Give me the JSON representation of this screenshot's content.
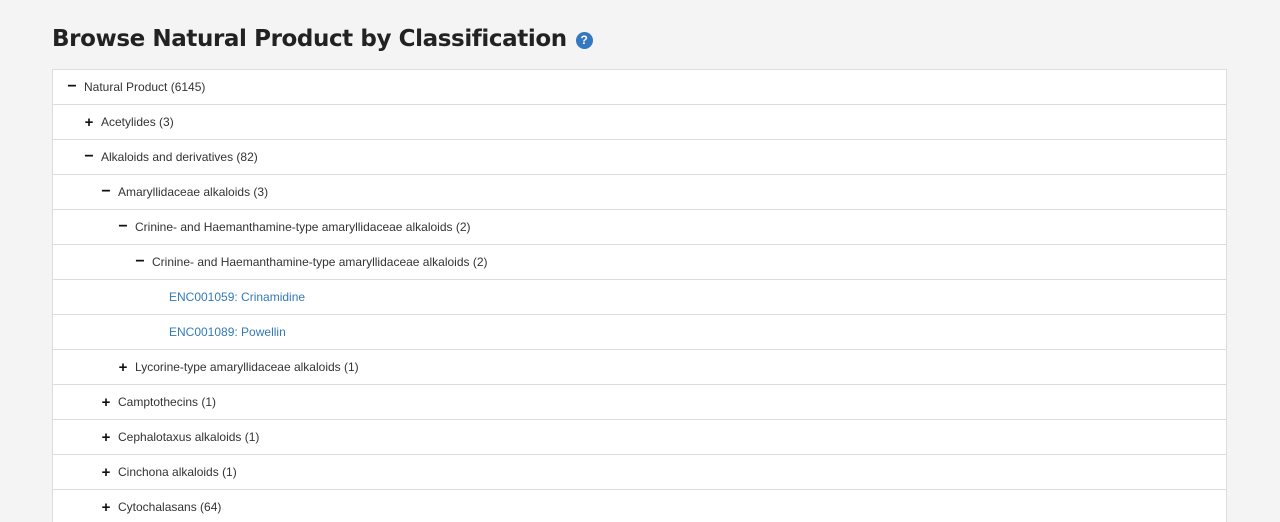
{
  "header": {
    "title": "Browse Natural Product by Classification",
    "help_icon": "question-circle-icon"
  },
  "colors": {
    "link": "#337ab7",
    "help_icon": "#3478c1",
    "border": "#dddddd",
    "page_background": "#f4f4f4"
  },
  "tree": {
    "rows": [
      {
        "id": "natural-product",
        "toggle": "−",
        "toggle_icon": "minus-icon",
        "label": "Natural Product (6145)"
      },
      {
        "id": "acetylides",
        "toggle": "+",
        "toggle_icon": "plus-icon",
        "label": "Acetylides (3)"
      },
      {
        "id": "alkaloids",
        "toggle": "−",
        "toggle_icon": "minus-icon",
        "label": "Alkaloids and derivatives (82)"
      },
      {
        "id": "amaryllidaceae",
        "toggle": "−",
        "toggle_icon": "minus-icon",
        "label": "Amaryllidaceae alkaloids (3)"
      },
      {
        "id": "crinine-1",
        "toggle": "−",
        "toggle_icon": "minus-icon",
        "label": "Crinine- and Haemanthamine-type amaryllidaceae alkaloids (2)"
      },
      {
        "id": "crinine-2",
        "toggle": "−",
        "toggle_icon": "minus-icon",
        "label": "Crinine- and Haemanthamine-type amaryllidaceae alkaloids (2)"
      },
      {
        "id": "enc001059",
        "label": "ENC001059: Crinamidine"
      },
      {
        "id": "enc001089",
        "label": "ENC001089: Powellin"
      },
      {
        "id": "lycorine",
        "toggle": "+",
        "toggle_icon": "plus-icon",
        "label": "Lycorine-type amaryllidaceae alkaloids (1)"
      },
      {
        "id": "camptothecins",
        "toggle": "+",
        "toggle_icon": "plus-icon",
        "label": "Camptothecins (1)"
      },
      {
        "id": "cephalotaxus",
        "toggle": "+",
        "toggle_icon": "plus-icon",
        "label": "Cephalotaxus alkaloids (1)"
      },
      {
        "id": "cinchona",
        "toggle": "+",
        "toggle_icon": "plus-icon",
        "label": "Cinchona alkaloids (1)"
      },
      {
        "id": "cytochalasans",
        "toggle": "+",
        "toggle_icon": "plus-icon",
        "label": "Cytochalasans (64)"
      }
    ]
  }
}
